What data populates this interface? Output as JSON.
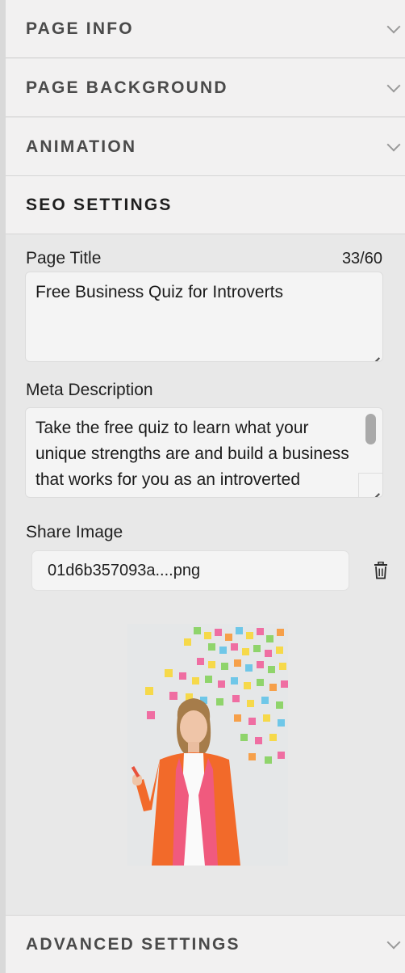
{
  "sections": {
    "page_info": "PAGE INFO",
    "page_background": "PAGE BACKGROUND",
    "animation": "ANIMATION",
    "seo_settings": "SEO SETTINGS",
    "advanced_settings": "ADVANCED SETTINGS"
  },
  "seo": {
    "page_title_label": "Page Title",
    "page_title_count": "33/60",
    "page_title_value": "Free Business Quiz for Introverts",
    "meta_description_label": "Meta Description",
    "meta_description_value": "Take the free quiz to learn what your unique strengths are and build a business that works for you as an introverted",
    "share_image_label": "Share Image",
    "share_image_filename": "01d6b357093a....png"
  },
  "icons": {
    "collapse": "chevron-down-icon",
    "delete": "trash-icon"
  },
  "colors": {
    "header_bg": "#f2f1f1",
    "panel_bg": "#e8e8e8",
    "field_bg": "#f4f4f4"
  }
}
